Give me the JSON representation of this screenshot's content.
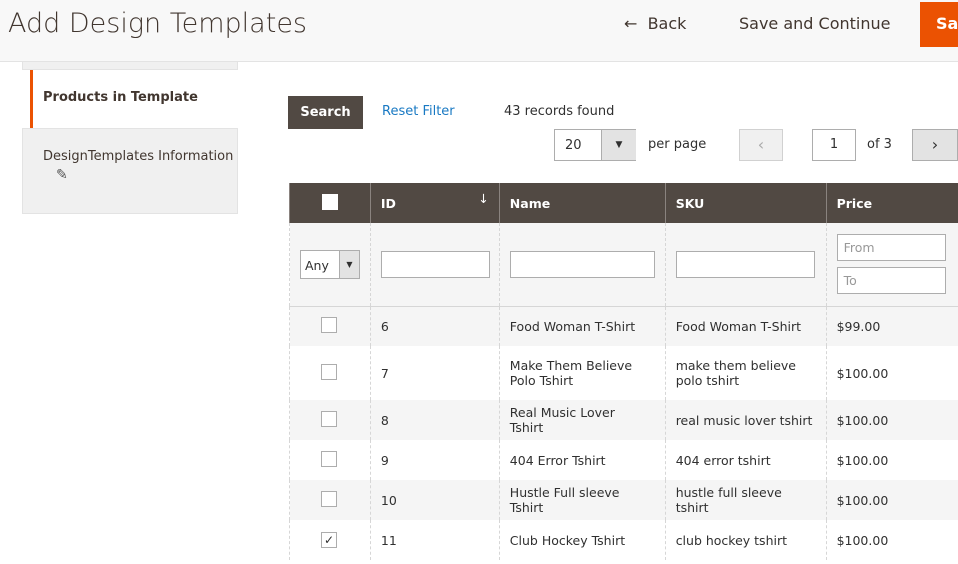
{
  "header": {
    "title": "Add Design Templates",
    "back": "Back",
    "save_continue": "Save and Continue",
    "save": "Save"
  },
  "tabs": [
    {
      "label": "Products in Template",
      "active": true
    },
    {
      "label": "DesignTemplates Information",
      "icon": "pencil-icon"
    }
  ],
  "toolbar": {
    "search": "Search",
    "reset": "Reset Filter",
    "records": "43 records found",
    "per_page_value": "20",
    "per_page_label": "per page",
    "page": "1",
    "of": "of 3"
  },
  "grid": {
    "columns": [
      "ID",
      "Name",
      "SKU",
      "Price"
    ],
    "filter": {
      "any": "Any",
      "price_from": "From",
      "price_to": "To"
    },
    "rows": [
      {
        "id": "6",
        "name": "Food Woman T-Shirt",
        "sku": "Food Woman T-Shirt",
        "price": "$99.00",
        "checked": false
      },
      {
        "id": "7",
        "name": "Make Them Believe Polo Tshirt",
        "sku": "make them believe polo tshirt",
        "price": "$100.00",
        "checked": false
      },
      {
        "id": "8",
        "name": "Real Music Lover Tshirt",
        "sku": "real music lover tshirt",
        "price": "$100.00",
        "checked": false
      },
      {
        "id": "9",
        "name": "404 Error Tshirt",
        "sku": "404 error tshirt",
        "price": "$100.00",
        "checked": false
      },
      {
        "id": "10",
        "name": "Hustle Full sleeve Tshirt",
        "sku": "hustle full sleeve tshirt",
        "price": "$100.00",
        "checked": false
      },
      {
        "id": "11",
        "name": "Club Hockey Tshirt",
        "sku": "club hockey tshirt",
        "price": "$100.00",
        "checked": true
      }
    ]
  },
  "colors": {
    "accent": "#eb5202",
    "header_dark": "#514943",
    "link": "#1979c3"
  }
}
